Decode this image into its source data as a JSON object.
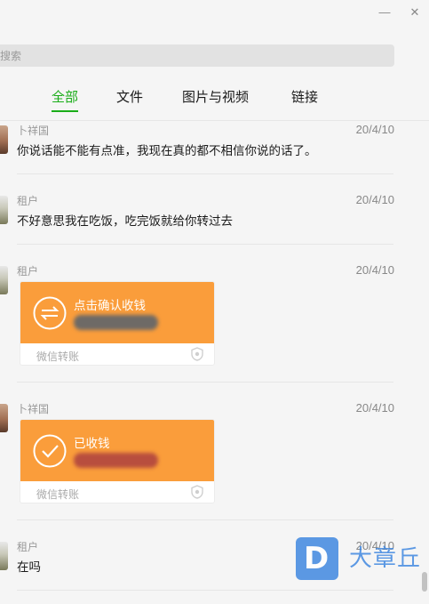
{
  "window": {
    "minimize_glyph": "—",
    "close_glyph": "✕"
  },
  "search": {
    "placeholder": "搜索"
  },
  "tabs": [
    {
      "label": "全部",
      "active": true
    },
    {
      "label": "文件",
      "active": false
    },
    {
      "label": "图片与视频",
      "active": false
    },
    {
      "label": "链接",
      "active": false
    }
  ],
  "messages": [
    {
      "sender": "卜祥国",
      "date": "20/4/10",
      "text": "你说话能不能有点准，我现在真的都不相信你说的话了。"
    },
    {
      "sender": "租户",
      "date": "20/4/10",
      "text": "不好意思我在吃饭，吃完饭就给你转过去"
    },
    {
      "sender": "租户",
      "date": "20/4/10",
      "card": {
        "title": "点击确认收钱",
        "footer": "微信转账",
        "icon": "transfer-arrows-icon"
      }
    },
    {
      "sender": "卜祥国",
      "date": "20/4/10",
      "card": {
        "title": "已收钱",
        "footer": "微信转账",
        "icon": "checkmark-icon"
      }
    },
    {
      "sender": "租户",
      "date": "20/4/10",
      "text": "在吗"
    }
  ],
  "watermark": {
    "letter": "D",
    "text": "大章丘"
  },
  "colors": {
    "accent": "#1aad19",
    "transfer_card": "#fa9d3b"
  }
}
